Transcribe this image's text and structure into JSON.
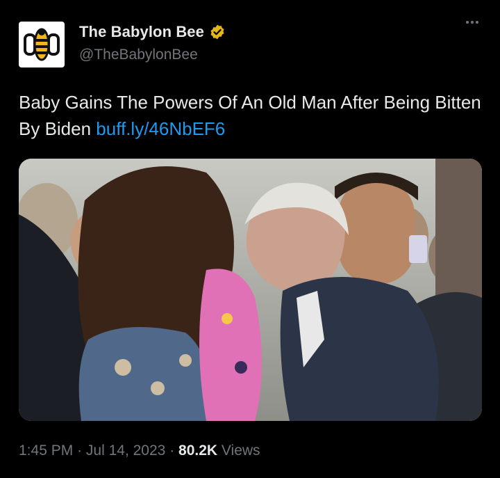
{
  "author": {
    "display_name": "The Babylon Bee",
    "handle": "@TheBabylonBee",
    "verified_color": "#e2b719",
    "avatar_icon": "bee-logo-icon"
  },
  "tweet": {
    "text": "Baby Gains The Powers Of An Old Man After Being Bitten By Biden ",
    "link": "buff.ly/46NbEF6"
  },
  "media": {
    "type": "photo"
  },
  "meta": {
    "time": "1:45 PM",
    "date": "Jul 14, 2023",
    "separator": "·",
    "views_count": "80.2K",
    "views_label": "Views"
  },
  "colors": {
    "background": "#000000",
    "text": "#e7e9ea",
    "secondary": "#71767b",
    "link": "#1d9bf0"
  }
}
